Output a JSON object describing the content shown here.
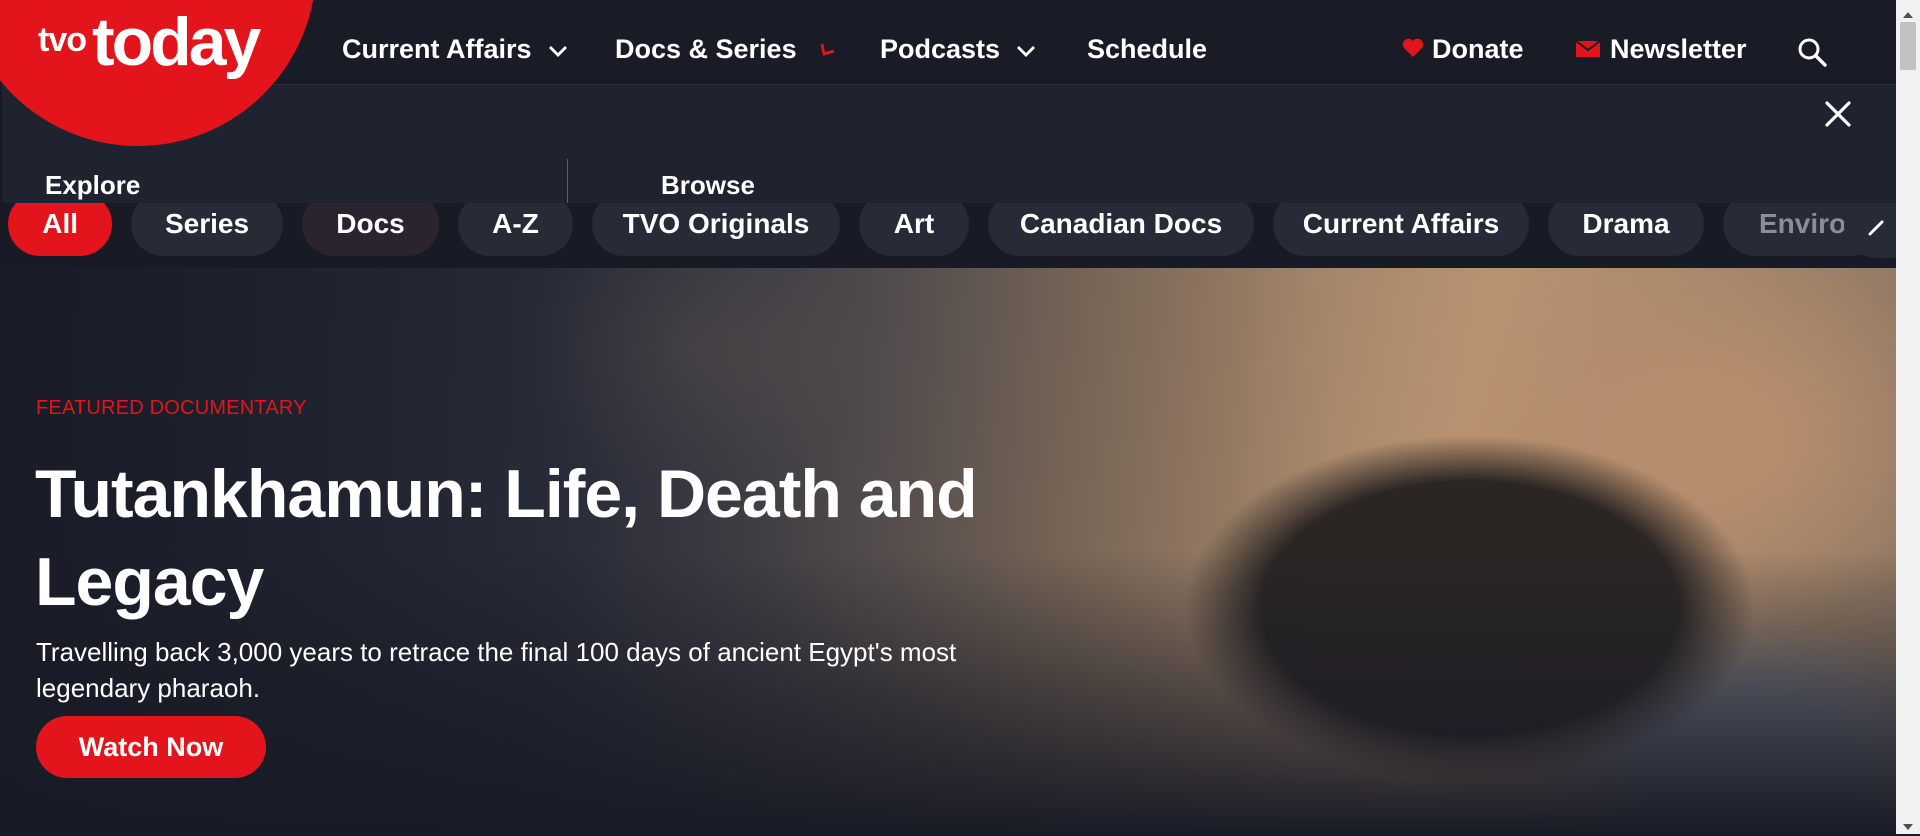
{
  "logo": {
    "part1": "tvo",
    "part2": "today"
  },
  "nav": {
    "items": [
      {
        "label": "Current Affairs",
        "icon": "chevron-down-icon"
      },
      {
        "label": "Docs & Series",
        "icon": "chevron-up-icon"
      },
      {
        "label": "Podcasts",
        "icon": "chevron-down-icon"
      },
      {
        "label": "Schedule"
      }
    ],
    "donate": {
      "label": "Donate",
      "icon": "heart-icon"
    },
    "newsletter": {
      "label": "Newsletter",
      "icon": "mail-icon"
    },
    "search_icon": "search-icon"
  },
  "panel": {
    "explore_label": "Explore",
    "browse_label": "Browse",
    "close_icon": "close-icon"
  },
  "chips": [
    "All",
    "Series",
    "Docs",
    "A-Z",
    "TVO Originals",
    "Art",
    "Canadian Docs",
    "Current Affairs",
    "Drama",
    "Environ"
  ],
  "hero": {
    "eyebrow": "FEATURED DOCUMENTARY",
    "title": "Tutankhamun: Life, Death and Legacy",
    "description": "Travelling back 3,000 years to retrace the final 100 days of ancient Egypt's most legendary pharaoh.",
    "cta": "Watch Now"
  },
  "colors": {
    "brand_red": "#e3141b",
    "nav_bg": "#191c27",
    "panel_bg": "#1f2330",
    "page_bg": "#181b26"
  }
}
